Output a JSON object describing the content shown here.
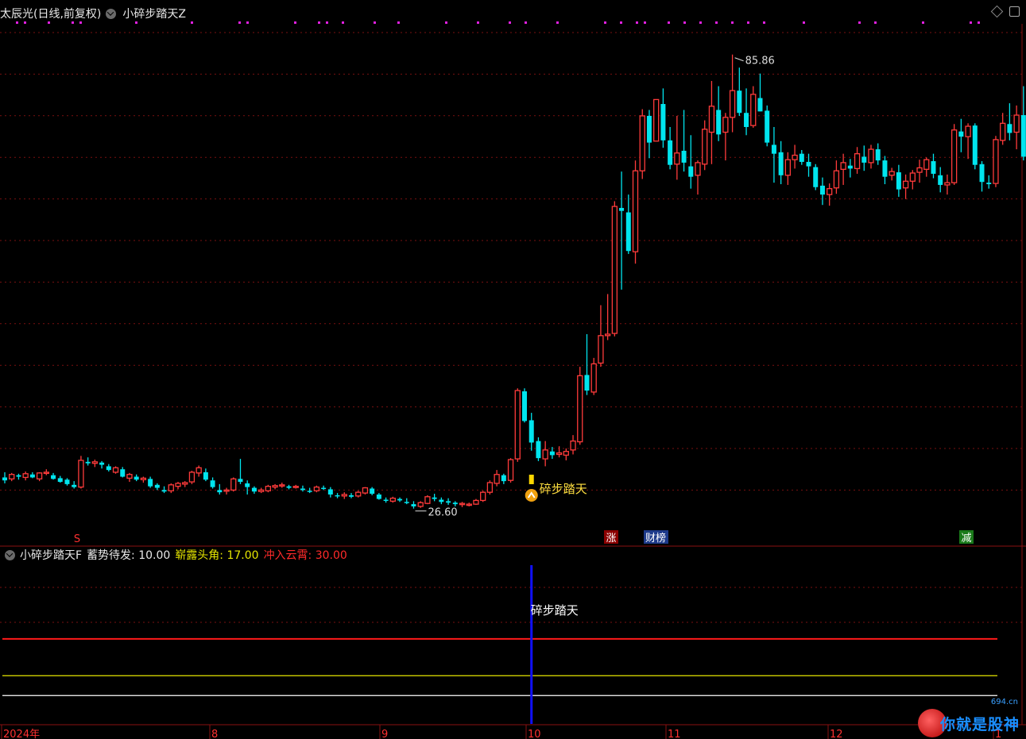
{
  "header": {
    "title": "太辰光(日线,前复权)",
    "indicator": "小碎步踏天Z"
  },
  "sub_header": {
    "indicator": "小碎步踏天F",
    "line1_label": "蓄势待发: 10.00",
    "line2_label": "崭露头角: 17.00",
    "line3_label": "冲入云霄: 30.00"
  },
  "colors": {
    "up": "#ff3b3b",
    "down": "#00e5ee",
    "line1": "#ffffff",
    "line2": "#e6e600",
    "line3": "#ff1a1a",
    "signal": "#1010ff",
    "dots": "#e020e0",
    "grid": "#7a1010"
  },
  "annotations": {
    "max_label": "85.86",
    "min_label": "26.60",
    "signal_label": "碎步踏天",
    "sub_signal_label": "碎步踏天",
    "event_s": "S",
    "event_zhang": "涨",
    "event_caibang": "财榜",
    "event_jian": "减"
  },
  "watermark": {
    "text": "你就是股神",
    "sub": "694.cn"
  },
  "chart_data": {
    "type": "candlestick",
    "ylim": [
      22,
      90
    ],
    "x_labels": [
      "2024年",
      "8",
      "9",
      "10",
      "11",
      "12",
      "1"
    ],
    "ohlc": [
      [
        28.9,
        29.6,
        28.1,
        28.5
      ],
      [
        28.7,
        29.5,
        28.4,
        29.3
      ],
      [
        29.2,
        29.4,
        28.6,
        29.0
      ],
      [
        28.9,
        29.7,
        28.5,
        29.4
      ],
      [
        29.3,
        29.6,
        28.8,
        28.9
      ],
      [
        28.7,
        29.6,
        28.4,
        29.5
      ],
      [
        29.6,
        30.0,
        29.2,
        29.6
      ],
      [
        29.2,
        29.5,
        28.6,
        28.7
      ],
      [
        28.8,
        29.1,
        28.2,
        28.3
      ],
      [
        28.6,
        28.8,
        27.8,
        28.0
      ],
      [
        27.9,
        28.4,
        27.4,
        27.6
      ],
      [
        27.6,
        31.8,
        27.4,
        31.2
      ],
      [
        31.0,
        31.6,
        30.5,
        30.8
      ],
      [
        30.8,
        31.3,
        30.3,
        31.0
      ],
      [
        30.9,
        31.1,
        30.1,
        30.6
      ],
      [
        30.4,
        30.7,
        29.7,
        29.9
      ],
      [
        29.6,
        30.4,
        29.4,
        30.2
      ],
      [
        30.0,
        30.3,
        28.9,
        29.0
      ],
      [
        28.8,
        29.5,
        28.3,
        29.3
      ],
      [
        29.0,
        29.3,
        28.4,
        28.6
      ],
      [
        28.6,
        29.0,
        28.2,
        28.8
      ],
      [
        28.7,
        29.0,
        27.5,
        27.7
      ],
      [
        27.9,
        28.1,
        27.2,
        27.5
      ],
      [
        27.2,
        27.7,
        26.8,
        27.0
      ],
      [
        27.1,
        28.1,
        26.8,
        27.9
      ],
      [
        27.7,
        28.3,
        27.3,
        28.1
      ],
      [
        28.0,
        28.4,
        27.6,
        28.2
      ],
      [
        28.3,
        29.8,
        28.0,
        29.6
      ],
      [
        29.5,
        30.5,
        29.0,
        30.2
      ],
      [
        29.6,
        30.1,
        28.4,
        28.6
      ],
      [
        28.5,
        28.9,
        27.4,
        27.6
      ],
      [
        27.2,
        28.0,
        26.6,
        26.9
      ],
      [
        27.1,
        27.5,
        26.6,
        27.2
      ],
      [
        27.2,
        28.9,
        27.0,
        28.7
      ],
      [
        28.7,
        31.4,
        28.0,
        28.3
      ],
      [
        28.1,
        28.5,
        26.6,
        27.6
      ],
      [
        27.5,
        27.7,
        26.7,
        27.0
      ],
      [
        27.0,
        27.5,
        26.8,
        27.2
      ],
      [
        27.1,
        27.9,
        26.9,
        27.7
      ],
      [
        27.6,
        28.0,
        27.3,
        27.8
      ],
      [
        27.8,
        28.2,
        27.5,
        27.9
      ],
      [
        27.7,
        27.9,
        27.3,
        27.5
      ],
      [
        27.6,
        27.9,
        27.4,
        27.7
      ],
      [
        27.4,
        27.8,
        27.0,
        27.2
      ],
      [
        27.1,
        27.5,
        26.8,
        27.0
      ],
      [
        27.1,
        27.8,
        26.9,
        27.6
      ],
      [
        27.5,
        27.8,
        27.2,
        27.4
      ],
      [
        27.3,
        27.6,
        26.2,
        26.6
      ],
      [
        26.5,
        26.8,
        26.1,
        26.4
      ],
      [
        26.4,
        26.9,
        26.0,
        26.6
      ],
      [
        26.5,
        26.8,
        26.1,
        26.3
      ],
      [
        26.4,
        27.1,
        26.2,
        26.9
      ],
      [
        26.8,
        27.6,
        26.6,
        27.5
      ],
      [
        27.4,
        27.6,
        26.5,
        26.7
      ],
      [
        26.6,
        26.8,
        25.9,
        26.0
      ],
      [
        25.9,
        26.2,
        25.5,
        25.8
      ],
      [
        25.7,
        26.3,
        25.5,
        26.1
      ],
      [
        26.0,
        26.2,
        25.6,
        25.8
      ],
      [
        25.6,
        26.1,
        25.3,
        25.5
      ],
      [
        25.3,
        25.7,
        24.7,
        25.0
      ],
      [
        25.0,
        25.7,
        24.8,
        25.5
      ],
      [
        25.4,
        26.5,
        25.3,
        26.3
      ],
      [
        26.2,
        26.7,
        25.7,
        26.0
      ],
      [
        25.9,
        26.2,
        25.3,
        25.6
      ],
      [
        25.7,
        26.1,
        25.2,
        25.5
      ],
      [
        25.5,
        25.7,
        25.0,
        25.3
      ],
      [
        25.3,
        25.6,
        24.9,
        25.4
      ],
      [
        25.2,
        25.5,
        25.0,
        25.3
      ],
      [
        25.3,
        26.0,
        25.2,
        25.8
      ],
      [
        25.8,
        27.1,
        25.6,
        26.9
      ],
      [
        26.9,
        28.5,
        26.6,
        28.2
      ],
      [
        28.1,
        29.9,
        27.7,
        29.3
      ],
      [
        29.2,
        29.4,
        28.0,
        28.4
      ],
      [
        28.5,
        31.5,
        28.2,
        31.3
      ],
      [
        31.4,
        40.9,
        31.0,
        40.6
      ],
      [
        40.5,
        40.9,
        36.3,
        36.5
      ],
      [
        36.6,
        37.6,
        32.5,
        33.6
      ],
      [
        33.8,
        34.3,
        31.1,
        31.5
      ],
      [
        31.4,
        33.8,
        30.4,
        32.6
      ],
      [
        32.4,
        33.0,
        31.4,
        31.9
      ],
      [
        32.0,
        33.1,
        31.6,
        32.2
      ],
      [
        31.9,
        32.8,
        31.2,
        32.4
      ],
      [
        32.6,
        34.6,
        32.0,
        33.8
      ],
      [
        33.7,
        43.8,
        33.3,
        42.6
      ],
      [
        42.7,
        48.2,
        40.0,
        40.6
      ],
      [
        40.4,
        45.0,
        40.0,
        44.2
      ],
      [
        44.3,
        52.1,
        43.8,
        48.0
      ],
      [
        48.0,
        53.6,
        47.4,
        48.2
      ],
      [
        48.3,
        66.1,
        47.9,
        65.4
      ],
      [
        65.2,
        70.1,
        54.2,
        64.8
      ],
      [
        64.6,
        67.0,
        59.0,
        59.4
      ],
      [
        59.3,
        71.6,
        57.7,
        70.2
      ],
      [
        70.2,
        78.5,
        69.1,
        77.6
      ],
      [
        77.6,
        78.4,
        71.9,
        74.0
      ],
      [
        74.2,
        72.4,
        74.8,
        79.8
      ],
      [
        79.2,
        81.3,
        73.3,
        74.3
      ],
      [
        74.3,
        76.1,
        70.4,
        71.0
      ],
      [
        71.1,
        77.6,
        69.0,
        72.6
      ],
      [
        72.9,
        78.4,
        70.1,
        71.3
      ],
      [
        70.8,
        75.0,
        67.8,
        69.4
      ],
      [
        69.6,
        71.6,
        67.0,
        71.3
      ],
      [
        71.1,
        77.0,
        70.3,
        75.8
      ],
      [
        75.4,
        82.3,
        71.1,
        78.9
      ],
      [
        78.4,
        81.6,
        74.2,
        75.1
      ],
      [
        75.4,
        78.0,
        71.6,
        77.4
      ],
      [
        77.4,
        85.86,
        75.4,
        81.0
      ],
      [
        81.0,
        84.1,
        77.6,
        78.0
      ],
      [
        78.0,
        81.3,
        75.0,
        76.1
      ],
      [
        76.3,
        81.6,
        76.0,
        80.5
      ],
      [
        80.0,
        83.3,
        78.6,
        78.2
      ],
      [
        78.3,
        79.0,
        73.5,
        74.0
      ],
      [
        73.7,
        76.1,
        68.6,
        72.5
      ],
      [
        72.7,
        74.2,
        68.4,
        69.6
      ],
      [
        69.6,
        72.7,
        68.3,
        71.7
      ],
      [
        71.7,
        73.7,
        70.5,
        72.3
      ],
      [
        72.5,
        73.0,
        71.0,
        71.4
      ],
      [
        71.4,
        72.5,
        69.4,
        70.8
      ],
      [
        70.7,
        71.1,
        67.6,
        68.0
      ],
      [
        68.2,
        69.3,
        65.6,
        67.0
      ],
      [
        67.0,
        68.5,
        65.5,
        67.8
      ],
      [
        67.9,
        71.6,
        67.1,
        70.2
      ],
      [
        70.4,
        72.5,
        68.3,
        71.3
      ],
      [
        70.9,
        71.8,
        69.3,
        70.5
      ],
      [
        70.5,
        73.4,
        69.8,
        72.5
      ],
      [
        72.1,
        73.6,
        70.2,
        71.3
      ],
      [
        71.3,
        73.7,
        70.5,
        73.1
      ],
      [
        73.1,
        73.9,
        71.0,
        71.6
      ],
      [
        71.6,
        72.2,
        68.4,
        69.4
      ],
      [
        69.6,
        70.6,
        68.9,
        70.1
      ],
      [
        70.0,
        71.0,
        66.7,
        67.7
      ],
      [
        67.9,
        69.7,
        66.4,
        68.8
      ],
      [
        68.8,
        70.3,
        67.7,
        69.9
      ],
      [
        70.0,
        71.7,
        68.6,
        70.6
      ],
      [
        70.4,
        72.0,
        69.4,
        71.7
      ],
      [
        71.5,
        72.5,
        69.2,
        69.8
      ],
      [
        69.6,
        70.7,
        67.3,
        68.3
      ],
      [
        68.3,
        69.7,
        67.0,
        68.6
      ],
      [
        68.6,
        76.5,
        68.3,
        75.7
      ],
      [
        75.5,
        77.2,
        72.7,
        74.8
      ],
      [
        74.8,
        76.6,
        71.8,
        76.2
      ],
      [
        76.3,
        76.6,
        70.4,
        71.0
      ],
      [
        71.1,
        71.5,
        67.4,
        68.7
      ],
      [
        68.6,
        69.6,
        67.8,
        68.4
      ],
      [
        68.5,
        74.9,
        68.0,
        74.4
      ],
      [
        74.3,
        78.0,
        73.7,
        76.6
      ],
      [
        76.5,
        79.3,
        74.3,
        75.3
      ],
      [
        75.4,
        79.0,
        73.1,
        77.7
      ],
      [
        77.7,
        81.6,
        71.6,
        72.1
      ],
      [
        72.8,
        85.8,
        71.2,
        80.6
      ]
    ],
    "sub_lines": {
      "蓄势待发": 10.0,
      "崭露头角": 17.0,
      "冲入云霄": 30.0
    },
    "sub_ylim": [
      0,
      56
    ],
    "signal_index": 76
  }
}
